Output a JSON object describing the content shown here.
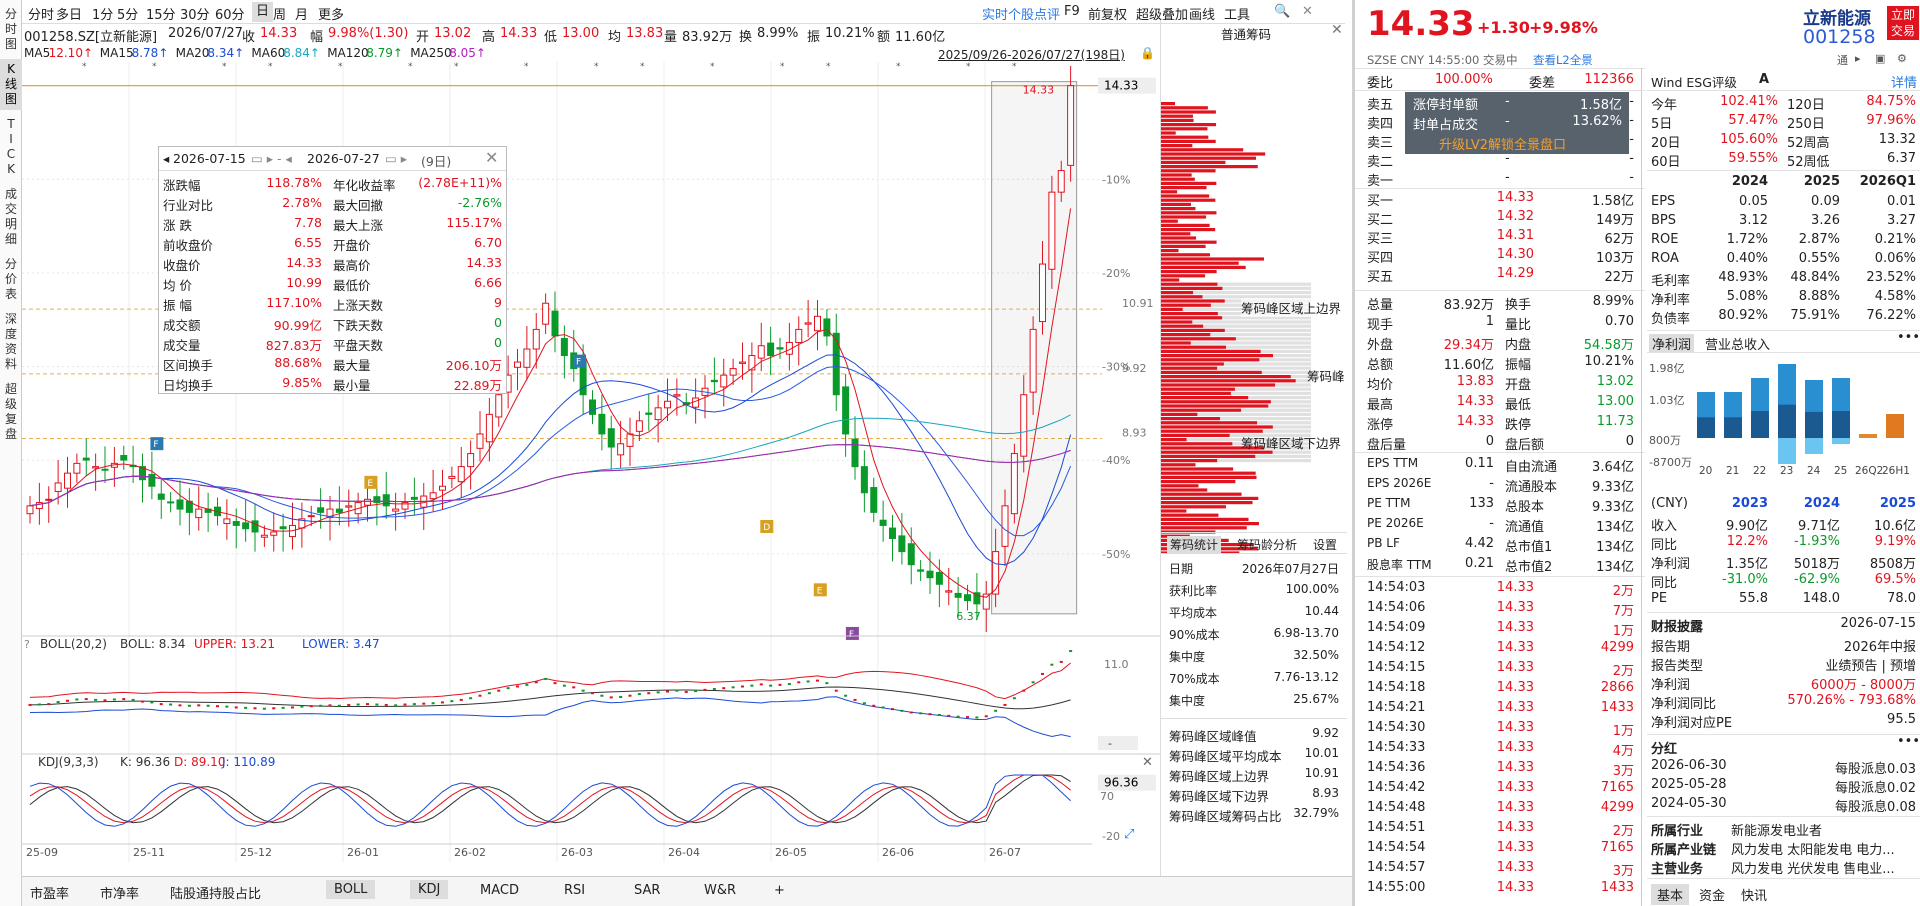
{
  "left_tabs": [
    "分时图",
    "K线图",
    "TICK",
    "成交明细",
    "分价表",
    "深度资料",
    "超级复盘"
  ],
  "topbar": {
    "items": [
      "分时",
      "多日",
      "1分",
      "5分",
      "15分",
      "30分",
      "60分",
      "日",
      "周",
      "月",
      "更多"
    ],
    "selected": "日",
    "right": [
      "实时个股点评",
      "F9",
      "前复权",
      "超级叠加",
      "画线",
      "工具"
    ]
  },
  "info": {
    "code": "001258.SZ[立新能源]",
    "date": "2026/07/27",
    "close_label": "收",
    "close": "14.33",
    "chg_label": "幅",
    "chg": "9.98%(1.30)",
    "open_label": "开",
    "open": "13.02",
    "high_label": "高",
    "high": "14.33",
    "low_label": "低",
    "low": "13.00",
    "avg_label": "均",
    "avg": "13.83",
    "vol_label": "量",
    "vol": "83.92万",
    "turn_label": "换",
    "turn": "8.99%",
    "amp_label": "振",
    "amp": "10.21%",
    "amt_label": "额",
    "amt": "11.60亿"
  },
  "ma": [
    {
      "label": "MA5",
      "val": "12.10↑",
      "color": "#e0141f"
    },
    {
      "label": "MA15",
      "val": "8.78↑",
      "color": "#1a4bd6"
    },
    {
      "label": "MA20",
      "val": "8.34↑",
      "color": "#1a4bd6"
    },
    {
      "label": "MA60",
      "val": "8.84↑",
      "color": "#1aa6c0"
    },
    {
      "label": "MA120",
      "val": "8.79↑",
      "color": "#0a9a2a"
    },
    {
      "label": "MA250",
      "val": "8.05↑",
      "color": "#b020c0"
    }
  ],
  "range_label": "2025/09/26-2026/07/27(198日)",
  "price_axis": {
    "top": "14.33",
    "ticks": [
      "-10%",
      "-20%",
      "-30%",
      "-40%",
      "-50%"
    ],
    "b1": "10.91",
    "b2": "9.92",
    "b3": "8.93",
    "min_label": "6.37",
    "max_label": "14.33"
  },
  "popup": {
    "d1": "2026-07-15",
    "d2": "2026-07-27",
    "days": "(9日)",
    "rows": [
      [
        "涨跌幅",
        "118.78%",
        "年化收益率",
        "(2.78E+11)%"
      ],
      [
        "行业对比",
        "2.78%",
        "最大回撤",
        "-2.76%"
      ],
      [
        "涨  跌",
        "7.78",
        "最大上涨",
        "115.17%"
      ],
      [
        "前收盘价",
        "6.55",
        "开盘价",
        "6.70"
      ],
      [
        "收盘价",
        "14.33",
        "最高价",
        "14.33"
      ],
      [
        "均  价",
        "10.99",
        "最低价",
        "6.66"
      ],
      [
        "振  幅",
        "117.10%",
        "上涨天数",
        "9"
      ],
      [
        "成交额",
        "90.99亿",
        "下跌天数",
        "0"
      ],
      [
        "成交量",
        "827.83万",
        "平盘天数",
        "0"
      ],
      [
        "区间换手",
        "88.68%",
        "最大量",
        "206.10万"
      ],
      [
        "日均换手",
        "9.85%",
        "最小量",
        "22.89万"
      ]
    ]
  },
  "boll": {
    "label": "BOLL(20,2)",
    "mid": "BOLL: 8.34",
    "up": "UPPER: 13.21",
    "low": "LOWER: 3.47",
    "axis_top": "11.0",
    "axis_bot": "-"
  },
  "kdj": {
    "label": "KDJ(9,3,3)",
    "k": "K: 96.36",
    "d": "D: 89.10",
    "j": "J: 110.89",
    "value": "96.36",
    "a70": "70",
    "a20": "-20"
  },
  "x_labels": [
    "25-09",
    "25-11",
    "25-12",
    "26-01",
    "26-02",
    "26-03",
    "26-04",
    "26-05",
    "26-06",
    "26-07"
  ],
  "bottom_tabs": [
    "市盈率",
    "市净率",
    "陆股通持股占比",
    "BOLL",
    "KDJ",
    "MACD",
    "RSI",
    "SAR",
    "W&R",
    "+"
  ],
  "chip": {
    "title": "普通筹码",
    "labels": {
      "upper": "筹码峰区域上边界",
      "peak": "筹码峰",
      "lower": "筹码峰区域下边界"
    },
    "tabs": [
      "筹码统计",
      "筹码龄分析",
      "设置"
    ],
    "stats": [
      [
        "日期",
        "2026年07月27日"
      ],
      [
        "获利比率",
        "100.00%"
      ],
      [
        "平均成本",
        "10.44"
      ],
      [
        "90%成本",
        "6.98-13.70"
      ],
      [
        "集中度",
        "32.50%"
      ],
      [
        "70%成本",
        "7.76-13.12"
      ],
      [
        "集中度",
        "25.67%"
      ]
    ],
    "stats2": [
      [
        "筹码峰区域峰值",
        "9.92"
      ],
      [
        "筹码峰区域平均成本",
        "10.01"
      ],
      [
        "筹码峰区域上边界",
        "10.91"
      ],
      [
        "筹码峰区域下边界",
        "8.93"
      ],
      [
        "筹码峰区域筹码占比",
        "32.79%"
      ]
    ]
  },
  "quote": {
    "price": "14.33",
    "chg": "+1.30",
    "pct": "+9.98%",
    "name": "立新能源",
    "code": "001258",
    "market": "SZSE  CNY  14:55:00  交易中",
    "l2": "查看L2全景",
    "trade_btn": "立即交易",
    "weibi_label": "委比",
    "weibi": "100.00%",
    "weicha_label": "委差",
    "weicha": "112366",
    "sell": [
      [
        "卖五",
        "-",
        "-"
      ],
      [
        "卖四",
        "-",
        "-"
      ],
      [
        "卖三",
        "-",
        "-"
      ],
      [
        "卖二",
        "-",
        "-"
      ],
      [
        "卖一",
        "-",
        "-"
      ]
    ],
    "overlay": [
      [
        "涨停封单额",
        "-",
        "1.58亿"
      ],
      [
        "封单占成交",
        "-",
        "13.62%"
      ]
    ],
    "overlay_btn": "升级LV2解锁全景盘口",
    "buy": [
      [
        "买一",
        "14.33",
        "1.58亿"
      ],
      [
        "买二",
        "14.32",
        "149万"
      ],
      [
        "买三",
        "14.31",
        "62万"
      ],
      [
        "买四",
        "14.30",
        "103万"
      ],
      [
        "买五",
        "14.29",
        "22万"
      ]
    ],
    "stats": [
      [
        "总量",
        "83.92万",
        "换手",
        "8.99%"
      ],
      [
        "现手",
        "1",
        "量比",
        "0.70"
      ],
      [
        "外盘",
        "29.34万",
        "内盘",
        "54.58万"
      ],
      [
        "总额",
        "11.60亿",
        "振幅",
        "10.21%"
      ],
      [
        "均价",
        "13.83",
        "开盘",
        "13.02"
      ],
      [
        "最高",
        "14.33",
        "最低",
        "13.00"
      ],
      [
        "涨停",
        "14.33",
        "跌停",
        "11.73"
      ],
      [
        "盘后量",
        "0",
        "盘后额",
        "0"
      ]
    ],
    "fin": [
      [
        "EPS TTM",
        "0.11",
        "自由流通",
        "3.64亿"
      ],
      [
        "EPS 2026E",
        "-",
        "流通股本",
        "9.33亿"
      ],
      [
        "PE TTM",
        "133",
        "总股本",
        "9.33亿"
      ],
      [
        "PE 2026E",
        "-",
        "流通值",
        "134亿"
      ],
      [
        "PB LF",
        "4.42",
        "总市值1",
        "134亿"
      ],
      [
        "股息率 TTM",
        "0.21",
        "总市值2",
        "134亿"
      ]
    ],
    "ticks": [
      [
        "14:54:03",
        "14.33",
        "2万"
      ],
      [
        "14:54:06",
        "14.33",
        "7万"
      ],
      [
        "14:54:09",
        "14.33",
        "1万"
      ],
      [
        "14:54:12",
        "14.33",
        "4299"
      ],
      [
        "14:54:15",
        "14.33",
        "2万"
      ],
      [
        "14:54:18",
        "14.33",
        "2866"
      ],
      [
        "14:54:21",
        "14.33",
        "1433"
      ],
      [
        "14:54:30",
        "14.33",
        "1万"
      ],
      [
        "14:54:33",
        "14.33",
        "4万"
      ],
      [
        "14:54:36",
        "14.33",
        "3万"
      ],
      [
        "14:54:42",
        "14.33",
        "7165"
      ],
      [
        "14:54:48",
        "14.33",
        "4299"
      ],
      [
        "14:54:51",
        "14.33",
        "2万"
      ],
      [
        "14:54:54",
        "14.33",
        "7165"
      ],
      [
        "14:54:57",
        "14.33",
        "3万"
      ],
      [
        "14:55:00",
        "14.33",
        "1433"
      ]
    ]
  },
  "wind": {
    "title": "Wind ESG评级",
    "rating": "A",
    "detail": "详情",
    "perf": [
      [
        "今年",
        "102.41%",
        "120日",
        "84.75%"
      ],
      [
        "5日",
        "57.47%",
        "250日",
        "97.96%"
      ],
      [
        "20日",
        "105.60%",
        "52周高",
        "13.32"
      ],
      [
        "60日",
        "59.55%",
        "52周低",
        "6.37"
      ]
    ],
    "years": [
      "2024",
      "2025",
      "2026Q1"
    ],
    "metrics": [
      [
        "EPS",
        "0.05",
        "0.09",
        "0.01"
      ],
      [
        "BPS",
        "3.12",
        "3.26",
        "3.27"
      ],
      [
        "ROE",
        "1.72%",
        "2.87%",
        "0.21%"
      ],
      [
        "ROA",
        "0.40%",
        "0.55%",
        "0.06%"
      ],
      [
        "毛利率",
        "48.93%",
        "48.84%",
        "23.52%"
      ],
      [
        "净利率",
        "5.08%",
        "8.88%",
        "4.58%"
      ],
      [
        "负债率",
        "80.92%",
        "75.91%",
        "76.22%"
      ]
    ],
    "tabs": [
      "净利润",
      "营业总收入"
    ],
    "bar_y": [
      "1.98亿",
      "1.03亿",
      "800万",
      "-8700万"
    ],
    "bar_x": [
      "20",
      "21",
      "22",
      "23",
      "24",
      "25",
      "26Q2",
      "26H1"
    ],
    "cny": "(CNY)",
    "cy": [
      "2023",
      "2024",
      "2025"
    ],
    "cm": [
      [
        "收入",
        "9.90亿",
        "9.71亿",
        "10.6亿"
      ],
      [
        "同比",
        "12.2%",
        "-1.93%",
        "9.19%"
      ],
      [
        "净利润",
        "1.35亿",
        "5018万",
        "8508万"
      ],
      [
        "同比",
        "-31.0%",
        "-62.9%",
        "69.5%"
      ],
      [
        "PE",
        "55.8",
        "148.0",
        "78.0"
      ]
    ],
    "report_title": "财报披露",
    "report_date": "2026-07-15",
    "report": [
      [
        "报告期",
        "2026年中报"
      ],
      [
        "报告类型",
        "业绩预告 | 预增"
      ],
      [
        "净利润",
        "6000万 - 8000万"
      ],
      [
        "净利润同比",
        "570.26% - 793.68%"
      ],
      [
        "净利润对应PE",
        "95.5"
      ]
    ],
    "div_title": "分红",
    "div": [
      [
        "2026-06-30",
        "每股派息0.03"
      ],
      [
        "2025-05-28",
        "每股派息0.02"
      ],
      [
        "2024-05-30",
        "每股派息0.08"
      ]
    ],
    "industry": [
      [
        "所属行业",
        "新能源发电业者"
      ],
      [
        "所属产业链",
        "风力发电  太阳能发电  电力..."
      ],
      [
        "主营业务",
        "风力发电  光伏发电  售电业..."
      ]
    ],
    "bottom_tabs": [
      "基本",
      "资金",
      "快讯"
    ]
  },
  "chart_data": {
    "type": "candlestick",
    "title": "001258.SZ[立新能源] 日K",
    "x_range": [
      "2025-09-26",
      "2026-07-27"
    ],
    "y_visible_labels": [
      "6.37",
      "8.93",
      "9.92",
      "10.91",
      "14.33"
    ],
    "ylim": [
      6.0,
      14.6
    ],
    "close": [
      7.9,
      7.95,
      8.0,
      8.25,
      8.4,
      8.55,
      8.6,
      8.5,
      8.45,
      8.55,
      8.6,
      8.5,
      8.3,
      8.2,
      8.0,
      7.95,
      7.85,
      7.8,
      7.85,
      7.8,
      7.75,
      7.7,
      7.6,
      7.55,
      7.5,
      7.45,
      7.5,
      7.55,
      7.6,
      7.7,
      7.75,
      7.8,
      7.85,
      7.8,
      7.9,
      7.95,
      8.0,
      7.95,
      7.9,
      7.85,
      7.95,
      8.0,
      8.05,
      8.1,
      8.2,
      8.35,
      8.5,
      8.7,
      9.0,
      9.3,
      9.6,
      9.9,
      10.1,
      10.3,
      10.6,
      11.0,
      10.5,
      10.2,
      10.0,
      9.6,
      9.3,
      9.0,
      8.8,
      8.85,
      9.0,
      9.2,
      9.3,
      9.4,
      9.5,
      9.6,
      9.45,
      9.55,
      9.7,
      9.8,
      9.9,
      10.0,
      10.1,
      10.2,
      10.35,
      10.2,
      10.3,
      10.4,
      10.6,
      10.7,
      10.8,
      10.5,
      9.6,
      9.0,
      8.5,
      8.1,
      7.8,
      7.6,
      7.4,
      7.2,
      7.0,
      6.9,
      6.8,
      6.7,
      6.6,
      6.5,
      6.45,
      6.4,
      6.55,
      7.2,
      7.9,
      8.7,
      9.6,
      10.6,
      11.6,
      12.7,
      13.03,
      14.33
    ]
  }
}
